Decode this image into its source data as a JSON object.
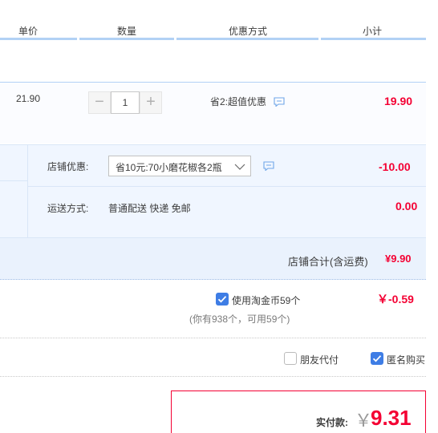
{
  "header": {
    "col_unit_price": "单价",
    "col_quantity": "数量",
    "col_discount": "优惠方式",
    "col_subtotal": "小计"
  },
  "item": {
    "price": "21.90",
    "quantity": "1",
    "minus": "−",
    "plus": "+",
    "promo": "省2:超值优惠",
    "subtotal": "19.90"
  },
  "shop": {
    "discount_label": "店铺优惠:",
    "discount_select": "省10元:70小磨花椒各2瓶",
    "discount_amount": "-10.00",
    "shipping_label": "运送方式:",
    "shipping_value": "普通配送 快递 免邮",
    "shipping_amount": "0.00",
    "total_label": "店铺合计(含运费)",
    "total_amount": "¥9.90"
  },
  "coins": {
    "label": "使用淘金币59个",
    "note": "(你有938个，可用59个)",
    "amount": "￥-0.59",
    "checked": true
  },
  "options": {
    "friend_pay": "朋友代付",
    "anonymous": "匿名购买"
  },
  "pay": {
    "label": "实付款:",
    "currency": "￥",
    "amount": "9.31"
  },
  "colors": {
    "accent_blue": "#3e7de5",
    "price_red": "#f40033"
  }
}
